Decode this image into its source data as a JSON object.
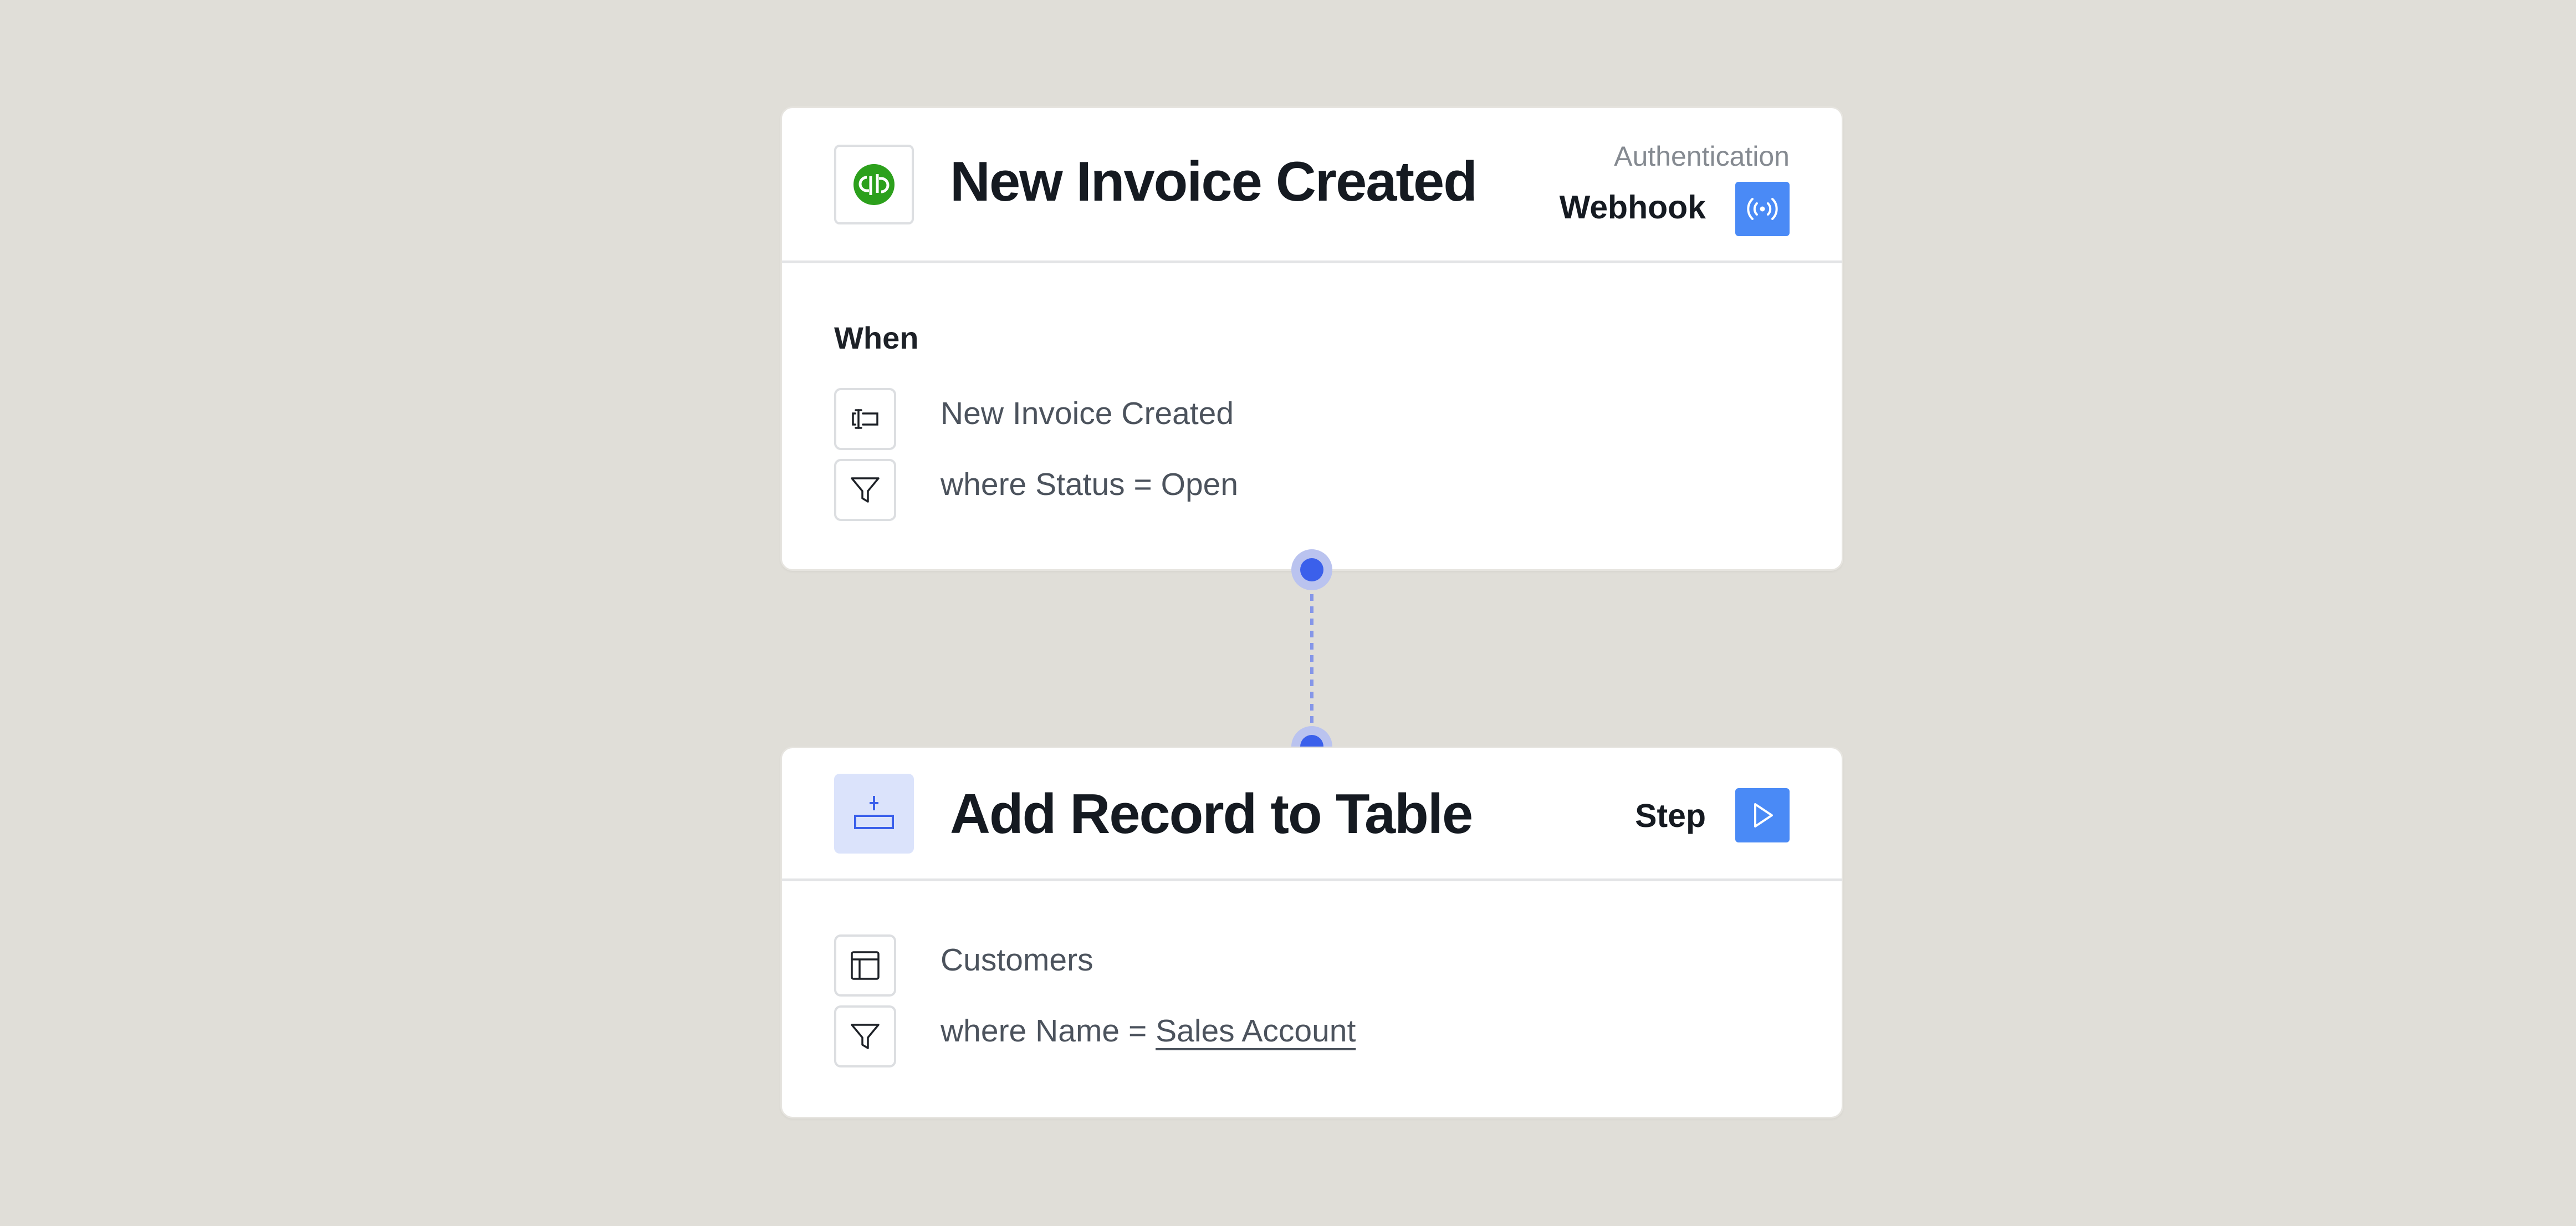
{
  "trigger": {
    "app_icon": "quickbooks-logo-icon",
    "title": "New Invoice Created",
    "auth_label": "Authentication",
    "mode_label": "Webhook",
    "mode_icon": "broadcast-icon",
    "section_label": "When",
    "rows": [
      {
        "icon": "text-cursor-icon",
        "text": "New Invoice Created"
      },
      {
        "icon": "filter-icon",
        "text": "where Status = Open"
      }
    ]
  },
  "step": {
    "app_icon": "add-record-icon",
    "title": "Add Record to Table",
    "mode_label": "Step",
    "mode_icon": "play-icon",
    "rows": [
      {
        "icon": "table-icon",
        "text": "Customers"
      },
      {
        "icon": "filter-icon",
        "text_prefix": "where Name = ",
        "text_value": "Sales Account"
      }
    ]
  },
  "colors": {
    "background": "#e0ded8",
    "accent_blue": "#4a8af6",
    "connector_node": "#3b60eb",
    "quickbooks_green": "#2ca01c"
  }
}
